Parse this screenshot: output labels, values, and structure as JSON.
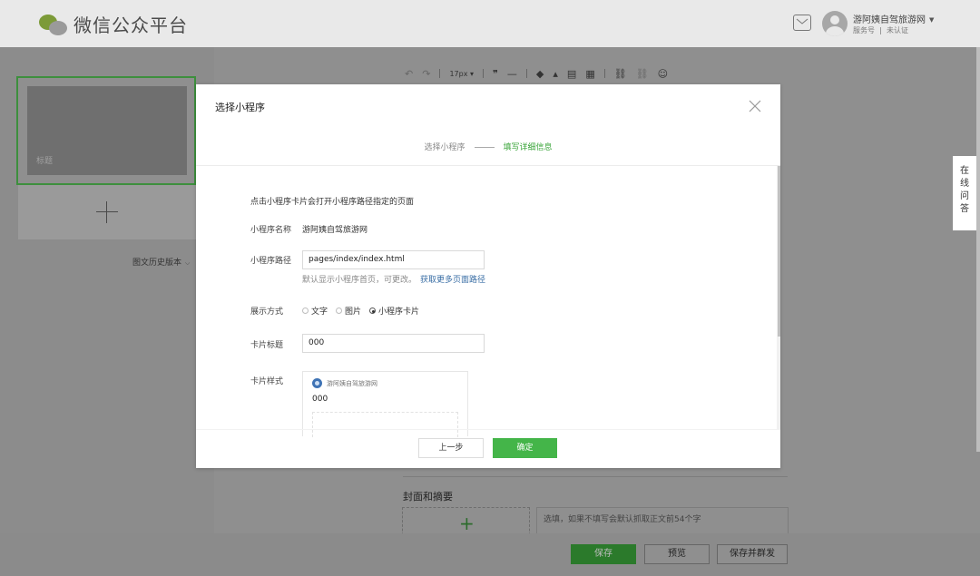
{
  "app": {
    "logo_text": "微信公众平台"
  },
  "account": {
    "name": "游阿姨自驾旅游网",
    "type": "服务号",
    "verify_status": "未认证"
  },
  "left_panel": {
    "cover_title": "标题",
    "history_link": "图文历史版本"
  },
  "toolbar": {
    "font_size": "17px"
  },
  "side_widget": {
    "chars": [
      "在",
      "线",
      "问",
      "答"
    ]
  },
  "editor": {
    "cover_section_title": "封面和摘要",
    "summary_placeholder": "选填，如果不填写会默认抓取正文前54个字"
  },
  "bottom_bar": {
    "save": "保存",
    "preview": "预览",
    "save_and_send": "保存并群发"
  },
  "modal": {
    "title": "选择小程序",
    "steps": [
      "选择小程序",
      "填写详细信息"
    ],
    "description": "点击小程序卡片会打开小程序路径指定的页面",
    "name_label": "小程序名称",
    "name_value": "游阿姨自驾旅游网",
    "path_label": "小程序路径",
    "path_value": "pages/index/index.html",
    "path_hint": "默认显示小程序首页，可更改。",
    "path_hint_link": "获取更多页面路径",
    "display_label": "展示方式",
    "display_options": [
      "文字",
      "图片",
      "小程序卡片"
    ],
    "display_selected": "小程序卡片",
    "card_title_label": "卡片标题",
    "card_title_value": "000",
    "card_style_label": "卡片样式",
    "card_preview_name": "游阿姨自驾旅游网",
    "card_preview_title": "000",
    "btn_prev": "上一步",
    "btn_ok": "确定"
  }
}
